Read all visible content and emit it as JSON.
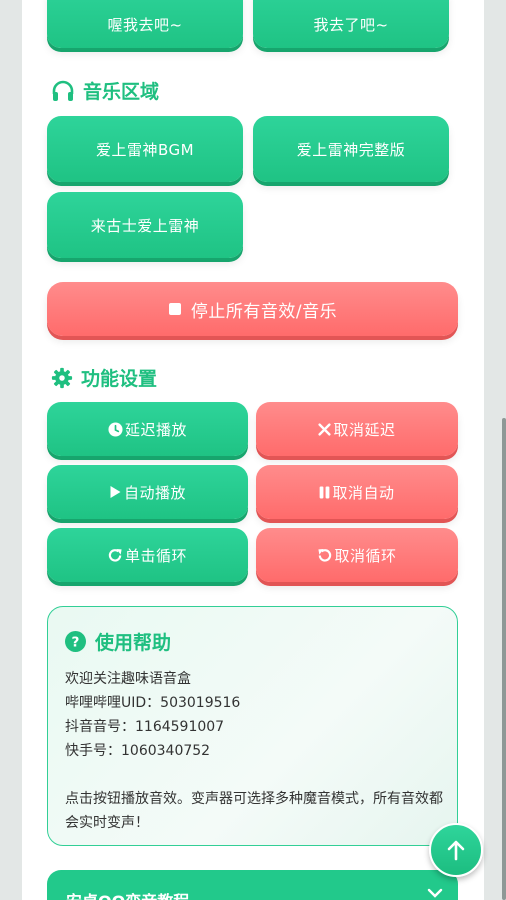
{
  "top_buttons": [
    "喔我去吧~",
    "我去了吧~"
  ],
  "music_section": {
    "title": "音乐区域",
    "icon": "headphones-icon",
    "buttons": [
      "爱上雷神BGM",
      "爱上雷神完整版",
      "来古士爱上雷神"
    ]
  },
  "stop_button": {
    "label": "停止所有音效/音乐",
    "icon": "stop-square-icon"
  },
  "settings_section": {
    "title": "功能设置",
    "icon": "gear-icon",
    "buttons": [
      {
        "label": "延迟播放",
        "icon": "clock-icon"
      },
      {
        "label": "取消延迟",
        "icon": "close-icon"
      },
      {
        "label": "自动播放",
        "icon": "play-icon"
      },
      {
        "label": "取消自动",
        "icon": "pause-icon"
      },
      {
        "label": "单击循环",
        "icon": "redo-icon"
      },
      {
        "label": "取消循环",
        "icon": "undo-icon"
      }
    ]
  },
  "help": {
    "title": "使用帮助",
    "icon": "question-circle-icon",
    "lines": [
      "欢迎关注趣味语音盒",
      "哔哩哔哩UID：503019516",
      "抖音音号：1164591007",
      "快手号：1060340752",
      "",
      "点击按钮播放音效。变声器可选择多种魔音模式，所有音效都会实时变声！"
    ]
  },
  "tutorial": {
    "label": "安卓QQ变音教程",
    "icon": "chevron-down-icon"
  },
  "colors": {
    "green": "#1fc384",
    "red": "#ff6b6b",
    "accent_text": "#1fbf80"
  }
}
